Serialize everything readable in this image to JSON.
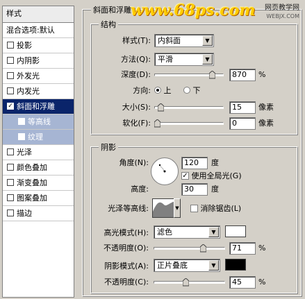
{
  "sidebar": {
    "title": "样式",
    "blend_options": "混合选项:默认",
    "items": [
      {
        "label": "投影",
        "checked": false
      },
      {
        "label": "内阴影",
        "checked": false
      },
      {
        "label": "外发光",
        "checked": false
      },
      {
        "label": "内发光",
        "checked": false
      },
      {
        "label": "斜面和浮雕",
        "checked": true,
        "selected": true
      },
      {
        "label": "等高线",
        "checked": false,
        "sub": true
      },
      {
        "label": "纹理",
        "checked": false,
        "sub": true
      },
      {
        "label": "光泽",
        "checked": false
      },
      {
        "label": "颜色叠加",
        "checked": false
      },
      {
        "label": "渐变叠加",
        "checked": false
      },
      {
        "label": "图案叠加",
        "checked": false
      },
      {
        "label": "描边",
        "checked": false
      }
    ]
  },
  "watermark": {
    "site": "www.68ps.com",
    "right_line1": "网页教学网",
    "right_line2": "WEBJX.COM"
  },
  "bevel": {
    "title": "斜面和浮雕",
    "structure_title": "结构",
    "style_label": "样式(T):",
    "style_value": "内斜面",
    "technique_label": "方法(Q):",
    "technique_value": "平滑",
    "depth_label": "深度(D):",
    "depth_value": "870",
    "depth_fraction": 0.87,
    "depth_unit": "%",
    "direction_label": "方向:",
    "direction_up": "上",
    "direction_down": "下",
    "size_label": "大小(S):",
    "size_value": "15",
    "size_fraction": 0.06,
    "size_unit": "像素",
    "soften_label": "软化(F):",
    "soften_value": "0",
    "soften_fraction": 0.0,
    "soften_unit": "像素"
  },
  "shading": {
    "title": "阴影",
    "angle_label": "角度(N):",
    "angle_value": "120",
    "angle_unit": "度",
    "global_light_label": "使用全局光(G)",
    "altitude_label": "高度:",
    "altitude_value": "30",
    "altitude_unit": "度",
    "gloss_label": "光泽等高线:",
    "antialias_label": "消除锯齿(L)",
    "highlight_label": "高光模式(H):",
    "highlight_value": "滤色",
    "highlight_color": "#ffffff",
    "hl_opacity_label": "不透明度(O):",
    "hl_opacity_value": "71",
    "hl_opacity_fraction": 0.71,
    "hl_opacity_unit": "%",
    "shadow_label": "阴影模式(A):",
    "shadow_value": "正片叠底",
    "shadow_color": "#000000",
    "sh_opacity_label": "不透明度(C):",
    "sh_opacity_value": "45",
    "sh_opacity_fraction": 0.45,
    "sh_opacity_unit": "%"
  }
}
